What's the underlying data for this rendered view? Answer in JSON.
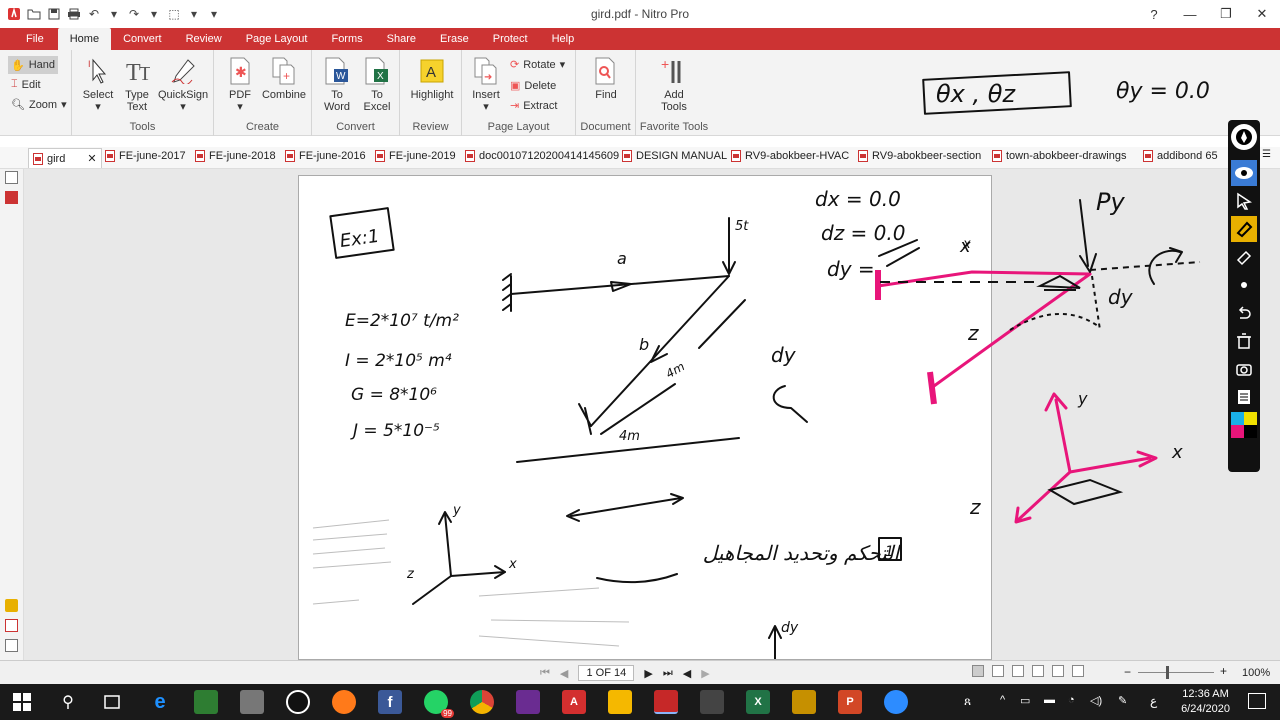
{
  "window": {
    "title": "gird.pdf - Nitro Pro"
  },
  "ribbon_tabs": [
    "File",
    "Home",
    "Convert",
    "Review",
    "Page Layout",
    "Forms",
    "Share",
    "Erase",
    "Protect",
    "Help"
  ],
  "ribbon": {
    "mode_hand": "Hand",
    "mode_edit": "Edit",
    "mode_zoom": "Zoom",
    "select": "Select",
    "type_text_1": "Type",
    "type_text_2": "Text",
    "quicksign": "QuickSign",
    "tools_group": "Tools",
    "pdf": "PDF",
    "combine": "Combine",
    "create_group": "Create",
    "to_word_1": "To",
    "to_word_2": "Word",
    "to_excel_1": "To",
    "to_excel_2": "Excel",
    "convert_group": "Convert",
    "highlight": "Highlight",
    "review_group": "Review",
    "insert": "Insert",
    "rotate": "Rotate",
    "delete": "Delete",
    "extract": "Extract",
    "page_layout_group": "Page Layout",
    "find": "Find",
    "document_group": "Document",
    "add_tools_1": "Add",
    "add_tools_2": "Tools",
    "favorite_tools_group": "Favorite Tools"
  },
  "doc_tabs": [
    "gird",
    "FE-june-2017",
    "FE-june-2018",
    "FE-june-2016",
    "FE-june-2019",
    "doc00107120200414145609",
    "DESIGN MANUAL",
    "RV9-abokbeer-HVAC",
    "RV9-abokbeer-section",
    "town-abokbeer-drawings",
    "addibond 65"
  ],
  "status": {
    "page_indicator": "1 OF 14",
    "zoom": "100%"
  },
  "taskbar": {
    "time": "12:36 AM",
    "date": "6/24/2020",
    "whatsapp_badge": "99",
    "lang": "ع"
  },
  "handwriting": {
    "ex_label": "Ex:1",
    "e_value": "E=2*10⁷ t/m²",
    "i_value": "I = 2*10⁵ m⁴",
    "g_value": "G = 8*10⁶",
    "j_value": "J = 5*10⁻⁵",
    "member_a": "a",
    "member_b": "b",
    "load": "5t",
    "len_4m_1": "4m",
    "len_4m_2": "4m",
    "theta_xz": "θx , θz",
    "theta_y": "θy = 0.0",
    "dx": "dx = 0.0",
    "dz": "dz = 0.0",
    "dy": "dy =",
    "py": "Py",
    "dy_label": "dy",
    "x_axis": "x",
    "z_axis": "z",
    "y_axis": "y",
    "arabic_title": "التحكم وتحديد المجاهيل",
    "arabic_num": "1"
  }
}
